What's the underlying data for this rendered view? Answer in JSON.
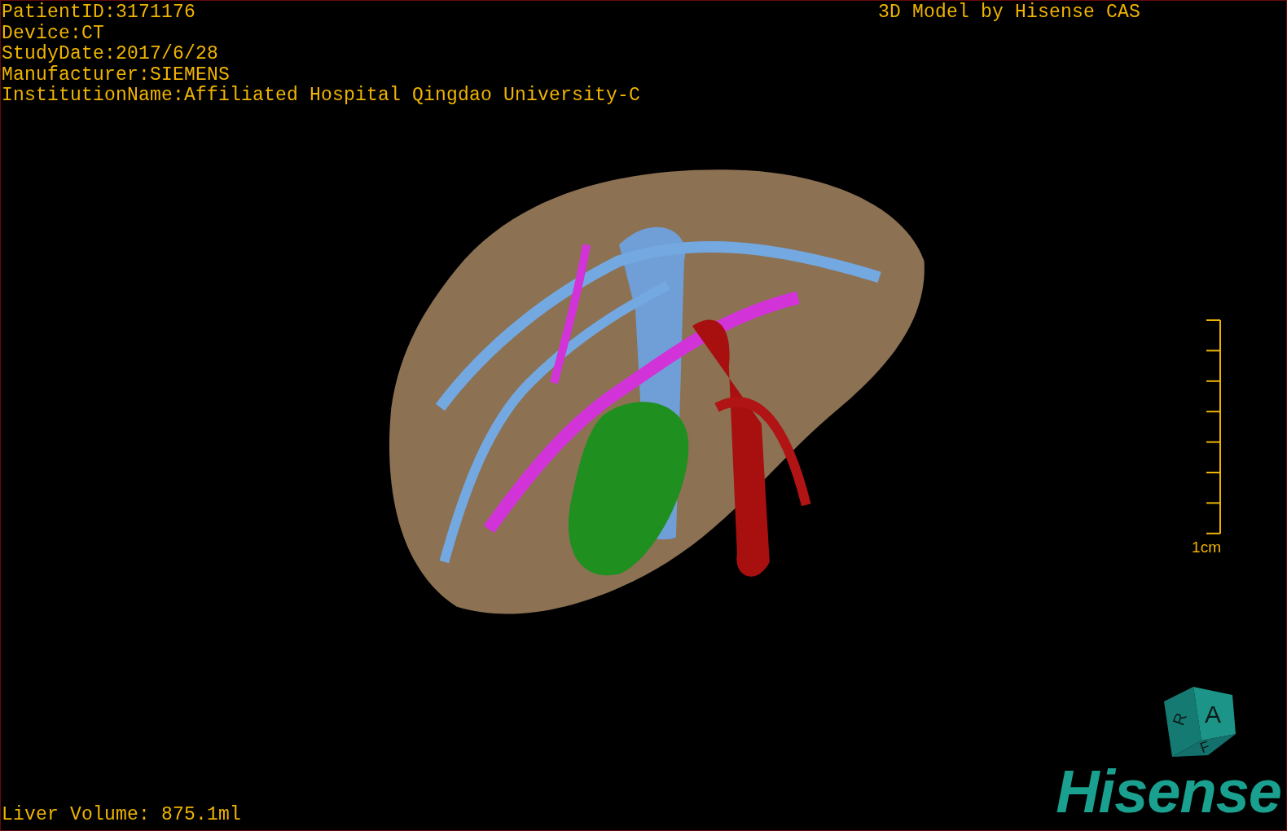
{
  "patient_info": [
    "PatientID:3171176",
    "Device:CT",
    "StudyDate:2017/6/28",
    "Manufacturer:SIEMENS",
    "InstitutionName:Affiliated Hospital Qingdao University-C"
  ],
  "model_credit": "3D Model by Hisense CAS",
  "scale_bar": {
    "label": "1cm"
  },
  "liver_volume": "Liver Volume: 875.1ml",
  "orientation_cube": {
    "labels": [
      "A",
      "R",
      "F"
    ]
  },
  "logo": "Hisense"
}
